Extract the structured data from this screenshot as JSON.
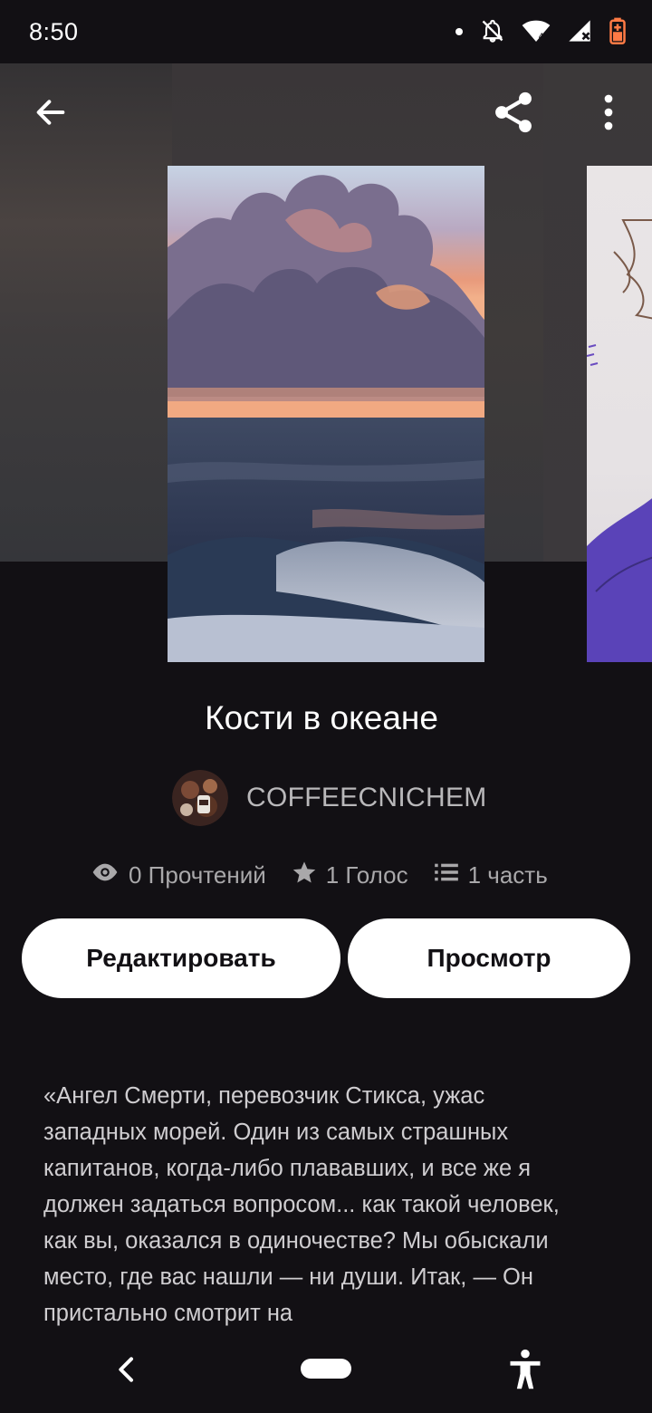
{
  "status_bar": {
    "time": "8:50",
    "icons": [
      "dot-icon",
      "bell-off-icon",
      "wifi-icon",
      "signal-icon",
      "battery-charging-icon"
    ]
  },
  "toolbar": {
    "back_icon": "arrow-left-icon",
    "share_icon": "share-icon",
    "more_icon": "more-vert-icon"
  },
  "story": {
    "title": "Кости в океане",
    "author": "COFFEECNICHEM",
    "stats": {
      "reads": "0 Прочтений",
      "votes": "1 Голос",
      "parts": "1 часть"
    },
    "edit_label": "Редактировать",
    "view_label": "Просмотр",
    "description": "«Ангел Смерти, перевозчик Стикса, ужас западных морей. Один из самых страшных капитанов, когда-либо плававших, и все же я должен задаться вопросом... как такой человек, как вы, оказался в одиночестве? Мы обыскали место, где вас нашли — ни души. Итак, — Он пристально смотрит на"
  },
  "colors": {
    "background": "#121014",
    "button_bg": "#ffffff",
    "secondary_text": "#a9a8aa"
  },
  "navbar": {
    "icons": [
      "nav-back-icon",
      "nav-home-pill",
      "accessibility-icon"
    ]
  }
}
